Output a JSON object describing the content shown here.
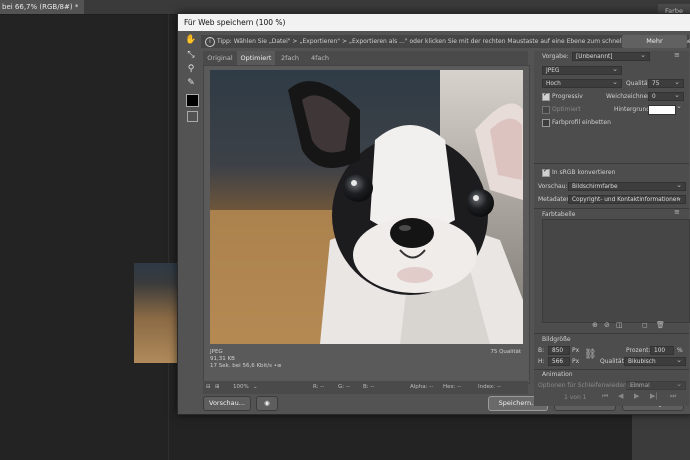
{
  "photoshop": {
    "doc_tab": "bei 66,7% (RGB/8#) *",
    "panel_tab": "Farbe"
  },
  "dialog": {
    "title": "Für Web speichern (100 %)",
    "tip": "Tipp: Wählen Sie „Datei\" > „Exportieren\" > „Exportieren als ...\" oder klicken Sie mit der rechten Maustaste auf eine Ebene zum schnelleren Export von Elementen.",
    "more_label": "Mehr",
    "tabs": [
      "Original",
      "Optimiert",
      "2fach",
      "4fach"
    ],
    "active_tab": "Optimiert",
    "preview_info": {
      "format": "JPEG",
      "size": "91,31 KB",
      "time": "17 Sek. bei 56,6 Kbit/s",
      "menu": "•≡",
      "quality": "75 Qualität"
    },
    "statusbar": {
      "zoom": "100%",
      "r": "R: --",
      "g": "G: --",
      "b": "B: --",
      "alpha": "Alpha: --",
      "hex": "Hex: --",
      "index": "Index: --"
    },
    "buttons": {
      "preview": "Vorschau...",
      "save": "Speichern...",
      "cancel": "Abbrechen",
      "done": "Fertig"
    },
    "settings": {
      "preset_label": "Vorgabe:",
      "preset_value": "[Unbenannt]",
      "format": "JPEG",
      "quality_level": "Hoch",
      "quality_label": "Qualität:",
      "quality_value": "75",
      "progressive_label": "Progressiv",
      "progressive_checked": true,
      "blur_label": "Weichzeichnen:",
      "blur_value": "0",
      "optimized_label": "Optimiert",
      "optimized_checked": false,
      "matte_label": "Hintergrund:",
      "embed_profile_label": "Farbprofil einbetten",
      "embed_profile_checked": false,
      "srgb_label": "In sRGB konvertieren",
      "srgb_checked": true,
      "preview_label": "Vorschau:",
      "preview_value": "Bildschirmfarbe",
      "metadata_label": "Metadaten:",
      "metadata_value": "Copyright- und Kontaktinformationen",
      "colortable_label": "Farbtabelle",
      "imagesize_label": "Bildgröße",
      "width_label": "B:",
      "width_value": "850",
      "width_unit": "Px",
      "height_label": "H:",
      "height_value": "566",
      "height_unit": "Px",
      "percent_label": "Prozent:",
      "percent_value": "100",
      "percent_unit": "%",
      "quality2_label": "Qualität:",
      "quality2_value": "Bikubisch",
      "animation_label": "Animation",
      "loop_label": "Optionen für Schleifenwiedergabe:",
      "loop_value": "Einmal",
      "frame_counter": "1 von 1"
    }
  }
}
